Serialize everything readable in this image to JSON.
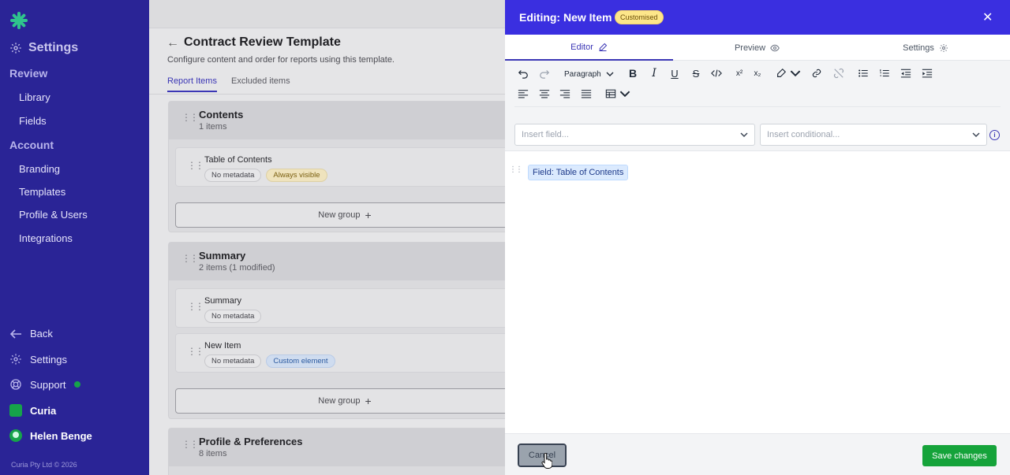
{
  "sidebar": {
    "settings_label": "Settings",
    "sections": [
      {
        "title": "Review",
        "items": [
          "Library",
          "Fields"
        ]
      },
      {
        "title": "Account",
        "items": [
          "Branding",
          "Templates",
          "Profile & Users",
          "Integrations"
        ]
      }
    ],
    "bottom": {
      "back": "Back",
      "settings": "Settings",
      "support": "Support",
      "org": "Curia",
      "user": "Helen Benge"
    },
    "copyright": "Curia Pty Ltd © 2026"
  },
  "main": {
    "title": "Contract Review Template",
    "subtitle": "Configure content and order for reports using this template.",
    "tabs": [
      "Report Items",
      "Excluded items"
    ],
    "groups": [
      {
        "title": "Contents",
        "count": "1 items",
        "items": [
          {
            "title": "Table of Contents",
            "badges": [
              "No metadata",
              "Always visible"
            ]
          }
        ]
      },
      {
        "title": "Summary",
        "count": "2 items (1 modified)",
        "items": [
          {
            "title": "Summary",
            "badges": [
              "No metadata"
            ]
          },
          {
            "title": "New Item",
            "badges": [
              "No metadata",
              "Custom element"
            ]
          }
        ]
      },
      {
        "title": "Profile & Preferences",
        "count": "8 items"
      }
    ],
    "new_group_label": "New group"
  },
  "drawer": {
    "title": "Editing: New Item",
    "badge": "Customised",
    "tabs": [
      "Editor",
      "Preview",
      "Settings"
    ],
    "toolbar": {
      "paragraph_label": "Paragraph",
      "superscript": "x²",
      "subscript": "x₂"
    },
    "insert_field_placeholder": "Insert field...",
    "insert_conditional_placeholder": "Insert conditional...",
    "field_chip": "Field: Table of Contents",
    "cancel_label": "Cancel",
    "save_label": "Save changes"
  },
  "colors": {
    "sidebar_bg": "#2a2496",
    "drawer_header": "#3a2fe0",
    "accent": "#3b36b5",
    "save_green": "#15a33a",
    "customised_badge": "#fde68a"
  }
}
